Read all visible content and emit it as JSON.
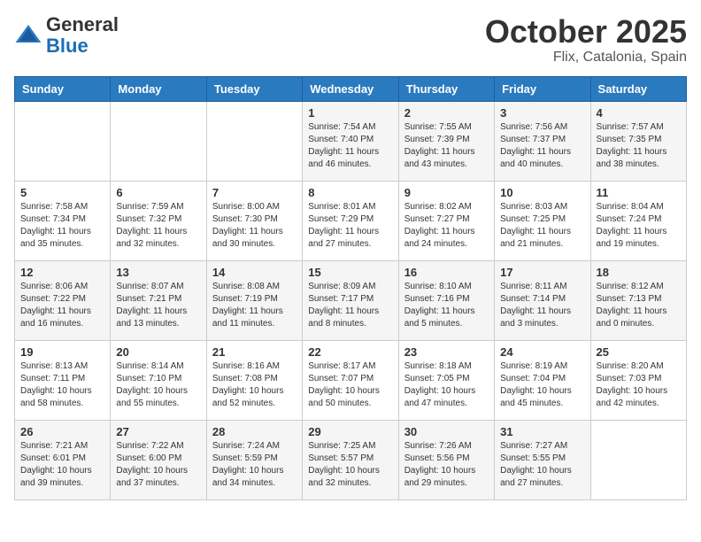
{
  "header": {
    "logo_general": "General",
    "logo_blue": "Blue",
    "month": "October 2025",
    "location": "Flix, Catalonia, Spain"
  },
  "days_of_week": [
    "Sunday",
    "Monday",
    "Tuesday",
    "Wednesday",
    "Thursday",
    "Friday",
    "Saturday"
  ],
  "weeks": [
    [
      {
        "day": "",
        "info": ""
      },
      {
        "day": "",
        "info": ""
      },
      {
        "day": "",
        "info": ""
      },
      {
        "day": "1",
        "info": "Sunrise: 7:54 AM\nSunset: 7:40 PM\nDaylight: 11 hours\nand 46 minutes."
      },
      {
        "day": "2",
        "info": "Sunrise: 7:55 AM\nSunset: 7:39 PM\nDaylight: 11 hours\nand 43 minutes."
      },
      {
        "day": "3",
        "info": "Sunrise: 7:56 AM\nSunset: 7:37 PM\nDaylight: 11 hours\nand 40 minutes."
      },
      {
        "day": "4",
        "info": "Sunrise: 7:57 AM\nSunset: 7:35 PM\nDaylight: 11 hours\nand 38 minutes."
      }
    ],
    [
      {
        "day": "5",
        "info": "Sunrise: 7:58 AM\nSunset: 7:34 PM\nDaylight: 11 hours\nand 35 minutes."
      },
      {
        "day": "6",
        "info": "Sunrise: 7:59 AM\nSunset: 7:32 PM\nDaylight: 11 hours\nand 32 minutes."
      },
      {
        "day": "7",
        "info": "Sunrise: 8:00 AM\nSunset: 7:30 PM\nDaylight: 11 hours\nand 30 minutes."
      },
      {
        "day": "8",
        "info": "Sunrise: 8:01 AM\nSunset: 7:29 PM\nDaylight: 11 hours\nand 27 minutes."
      },
      {
        "day": "9",
        "info": "Sunrise: 8:02 AM\nSunset: 7:27 PM\nDaylight: 11 hours\nand 24 minutes."
      },
      {
        "day": "10",
        "info": "Sunrise: 8:03 AM\nSunset: 7:25 PM\nDaylight: 11 hours\nand 21 minutes."
      },
      {
        "day": "11",
        "info": "Sunrise: 8:04 AM\nSunset: 7:24 PM\nDaylight: 11 hours\nand 19 minutes."
      }
    ],
    [
      {
        "day": "12",
        "info": "Sunrise: 8:06 AM\nSunset: 7:22 PM\nDaylight: 11 hours\nand 16 minutes."
      },
      {
        "day": "13",
        "info": "Sunrise: 8:07 AM\nSunset: 7:21 PM\nDaylight: 11 hours\nand 13 minutes."
      },
      {
        "day": "14",
        "info": "Sunrise: 8:08 AM\nSunset: 7:19 PM\nDaylight: 11 hours\nand 11 minutes."
      },
      {
        "day": "15",
        "info": "Sunrise: 8:09 AM\nSunset: 7:17 PM\nDaylight: 11 hours\nand 8 minutes."
      },
      {
        "day": "16",
        "info": "Sunrise: 8:10 AM\nSunset: 7:16 PM\nDaylight: 11 hours\nand 5 minutes."
      },
      {
        "day": "17",
        "info": "Sunrise: 8:11 AM\nSunset: 7:14 PM\nDaylight: 11 hours\nand 3 minutes."
      },
      {
        "day": "18",
        "info": "Sunrise: 8:12 AM\nSunset: 7:13 PM\nDaylight: 11 hours\nand 0 minutes."
      }
    ],
    [
      {
        "day": "19",
        "info": "Sunrise: 8:13 AM\nSunset: 7:11 PM\nDaylight: 10 hours\nand 58 minutes."
      },
      {
        "day": "20",
        "info": "Sunrise: 8:14 AM\nSunset: 7:10 PM\nDaylight: 10 hours\nand 55 minutes."
      },
      {
        "day": "21",
        "info": "Sunrise: 8:16 AM\nSunset: 7:08 PM\nDaylight: 10 hours\nand 52 minutes."
      },
      {
        "day": "22",
        "info": "Sunrise: 8:17 AM\nSunset: 7:07 PM\nDaylight: 10 hours\nand 50 minutes."
      },
      {
        "day": "23",
        "info": "Sunrise: 8:18 AM\nSunset: 7:05 PM\nDaylight: 10 hours\nand 47 minutes."
      },
      {
        "day": "24",
        "info": "Sunrise: 8:19 AM\nSunset: 7:04 PM\nDaylight: 10 hours\nand 45 minutes."
      },
      {
        "day": "25",
        "info": "Sunrise: 8:20 AM\nSunset: 7:03 PM\nDaylight: 10 hours\nand 42 minutes."
      }
    ],
    [
      {
        "day": "26",
        "info": "Sunrise: 7:21 AM\nSunset: 6:01 PM\nDaylight: 10 hours\nand 39 minutes."
      },
      {
        "day": "27",
        "info": "Sunrise: 7:22 AM\nSunset: 6:00 PM\nDaylight: 10 hours\nand 37 minutes."
      },
      {
        "day": "28",
        "info": "Sunrise: 7:24 AM\nSunset: 5:59 PM\nDaylight: 10 hours\nand 34 minutes."
      },
      {
        "day": "29",
        "info": "Sunrise: 7:25 AM\nSunset: 5:57 PM\nDaylight: 10 hours\nand 32 minutes."
      },
      {
        "day": "30",
        "info": "Sunrise: 7:26 AM\nSunset: 5:56 PM\nDaylight: 10 hours\nand 29 minutes."
      },
      {
        "day": "31",
        "info": "Sunrise: 7:27 AM\nSunset: 5:55 PM\nDaylight: 10 hours\nand 27 minutes."
      },
      {
        "day": "",
        "info": ""
      }
    ]
  ]
}
